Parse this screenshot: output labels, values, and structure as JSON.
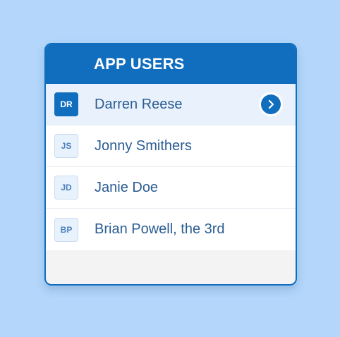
{
  "colors": {
    "page_background": "#b3d6fa",
    "accent": "#116ebf",
    "selected_row": "#e9f2fc",
    "footer": "#f3f3f3"
  },
  "header": {
    "title": "APP USERS"
  },
  "users": [
    {
      "initials": "DR",
      "name": "Darren Reese",
      "selected": true
    },
    {
      "initials": "JS",
      "name": "Jonny Smithers",
      "selected": false
    },
    {
      "initials": "JD",
      "name": "Janie Doe",
      "selected": false
    },
    {
      "initials": "BP",
      "name": "Brian Powell, the 3rd",
      "selected": false
    }
  ],
  "selected_action_icon": "chevron-right-icon"
}
